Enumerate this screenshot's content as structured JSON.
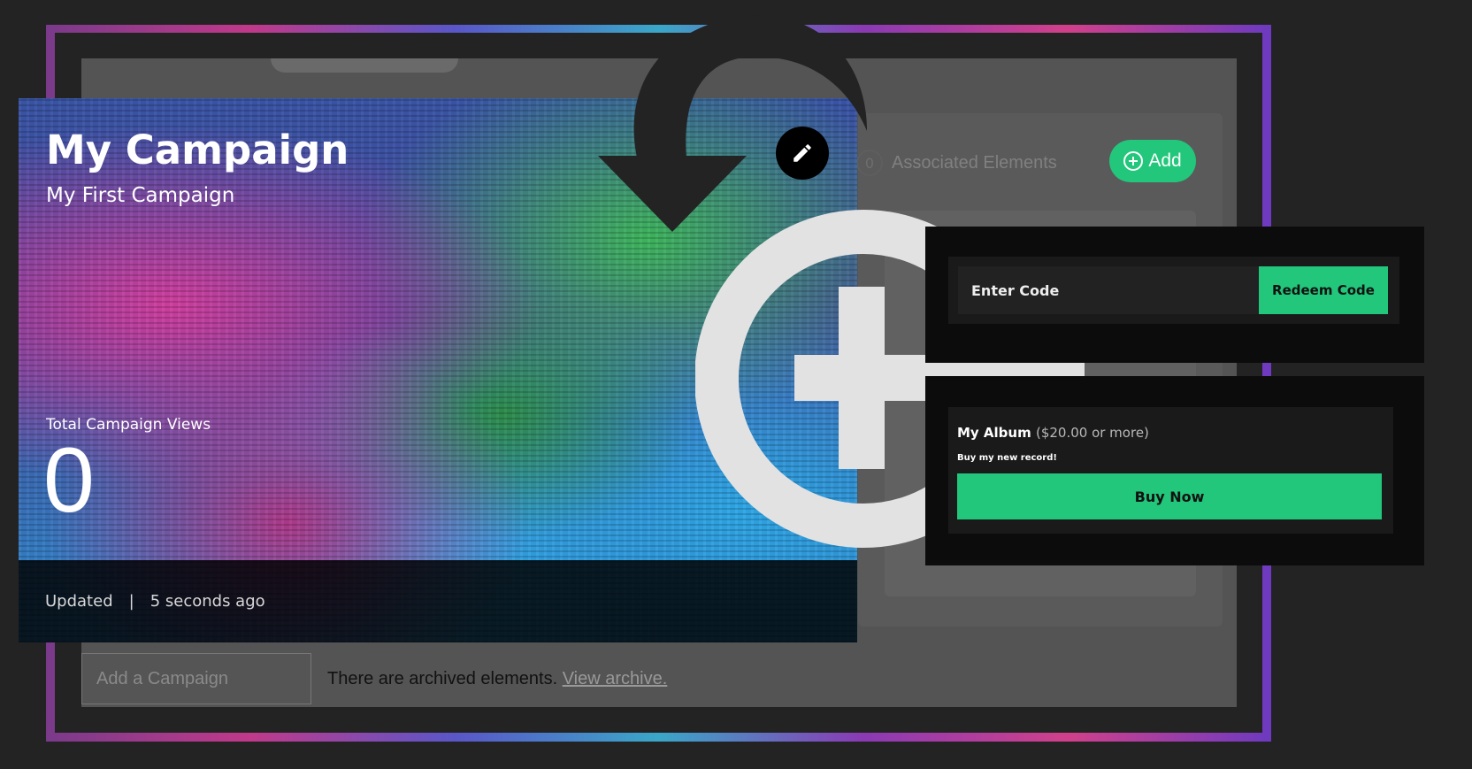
{
  "background_panel": {
    "associated_count": "0",
    "associated_label": "Associated Elements",
    "add_label": "Add",
    "add_campaign_placeholder": "Add a Campaign",
    "archive_text": "There are archived elements.",
    "archive_link": "View archive."
  },
  "campaign_card": {
    "title": "My Campaign",
    "subtitle": "My First Campaign",
    "views_label": "Total Campaign Views",
    "views_count": "0",
    "updated_label": "Updated",
    "separator": "|",
    "updated_time": "5 seconds ago"
  },
  "redeem": {
    "placeholder": "Enter Code",
    "button_label": "Redeem Code"
  },
  "album": {
    "title": "My Album",
    "price": "($20.00 or more)",
    "description": "Buy my new record!",
    "button_label": "Buy Now"
  },
  "colors": {
    "accent_green": "#22c77b",
    "background": "#232323"
  },
  "icons": [
    "pencil-icon",
    "curved-arrow-icon",
    "plus-circle-icon"
  ]
}
